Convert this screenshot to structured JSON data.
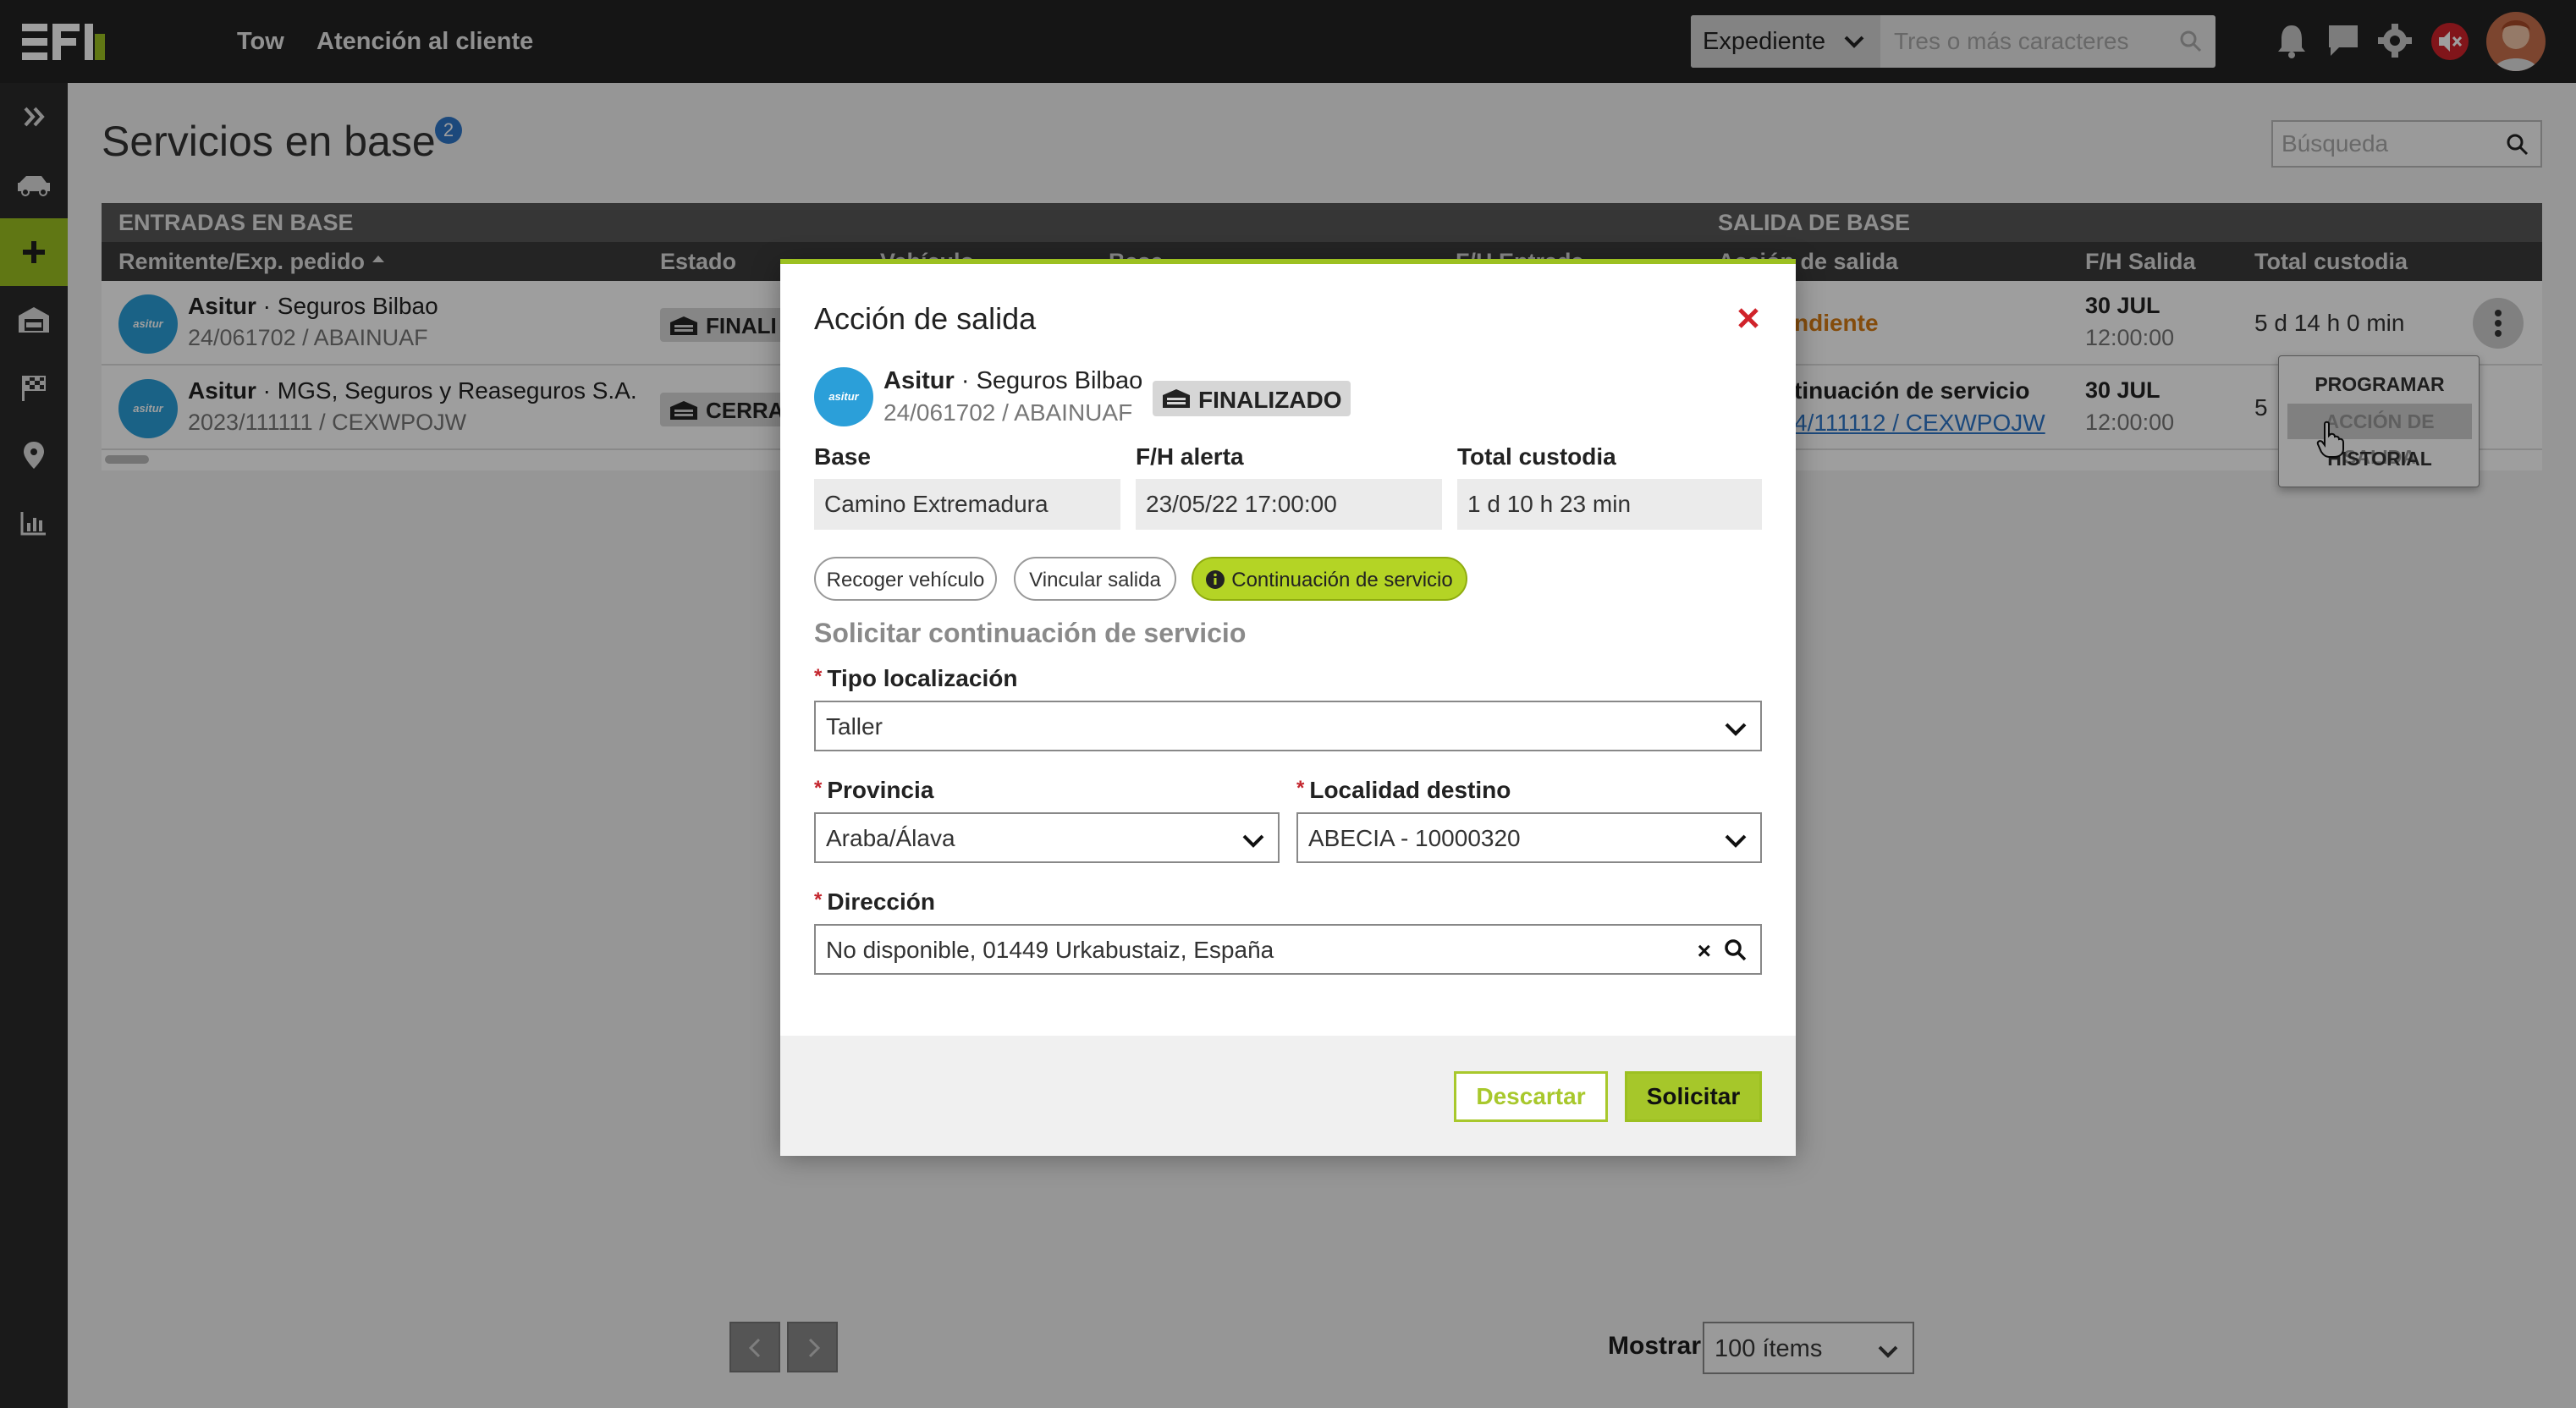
{
  "topbar": {
    "nav": [
      "Tow",
      "Atención al cliente"
    ],
    "search": {
      "select_value": "Expediente",
      "placeholder": "Tres o más caracteres"
    }
  },
  "page": {
    "title": "Servicios en base",
    "badge_count": "2",
    "search_placeholder": "Búsqueda"
  },
  "table": {
    "group_headers": {
      "entradas": "ENTRADAS EN BASE",
      "salida": "SALIDA DE BASE"
    },
    "columns": {
      "remitente": "Remitente/Exp. pedido",
      "estado": "Estado",
      "vehiculo": "Vehículo",
      "base": "Base",
      "fh_entrada": "F/H Entrada",
      "accion": "Acción de salida",
      "fh_salida": "F/H Salida",
      "total": "Total custodia"
    },
    "rows": [
      {
        "client": "Asitur",
        "company": "Seguros Bilbao",
        "expedient": "24/061702 / ABAINUAF",
        "estado": "FINALI",
        "accion": "ndiente",
        "fh_date": "30 JUL",
        "fh_time": "12:00:00",
        "total": "5 d 14 h 0 min"
      },
      {
        "client": "Asitur",
        "company": "MGS, Seguros y Reaseguros S.A.",
        "expedient": "2023/111111 / CEXWPOJW",
        "estado": "CERRA",
        "accion": "tinuación de servicio",
        "accion_link": "4/111112 / CEXWPOJW",
        "fh_date": "30 JUL",
        "fh_time": "12:00:00",
        "total": "5"
      }
    ]
  },
  "context_menu": [
    "PROGRAMAR ALERTA",
    "ACCIÓN DE SALIDA",
    "HISTORIAL"
  ],
  "pagination": {
    "mostrar_label": "Mostrar",
    "items_value": "100 ítems"
  },
  "modal": {
    "title": "Acción de salida",
    "client": "Asitur",
    "company": "Seguros Bilbao",
    "expedient": "24/061702 / ABAINUAF",
    "status": "FINALIZADO",
    "base_label": "Base",
    "base_value": "Camino Extremadura",
    "fh_alerta_label": "F/H alerta",
    "fh_alerta_value": "23/05/22 17:00:00",
    "total_label": "Total custodia",
    "total_value": "1 d 10 h 23 min",
    "options": [
      "Recoger vehículo",
      "Vincular salida",
      "Continuación de servicio"
    ],
    "section_title": "Solicitar continuación de servicio",
    "tipo_label": "Tipo localización",
    "tipo_value": "Taller",
    "provincia_label": "Provincia",
    "provincia_value": "Araba/Álava",
    "localidad_label": "Localidad destino",
    "localidad_value": "ABECIA - 10000320",
    "direccion_label": "Dirección",
    "direccion_value": "No disponible, 01449 Urkabustaiz, España",
    "descartar": "Descartar",
    "solicitar": "Solicitar"
  },
  "colors": {
    "accent": "#9cc021",
    "badge_blue": "#2e76c8",
    "close_red": "#d0232a",
    "client_logo": "#2b9fd9"
  }
}
